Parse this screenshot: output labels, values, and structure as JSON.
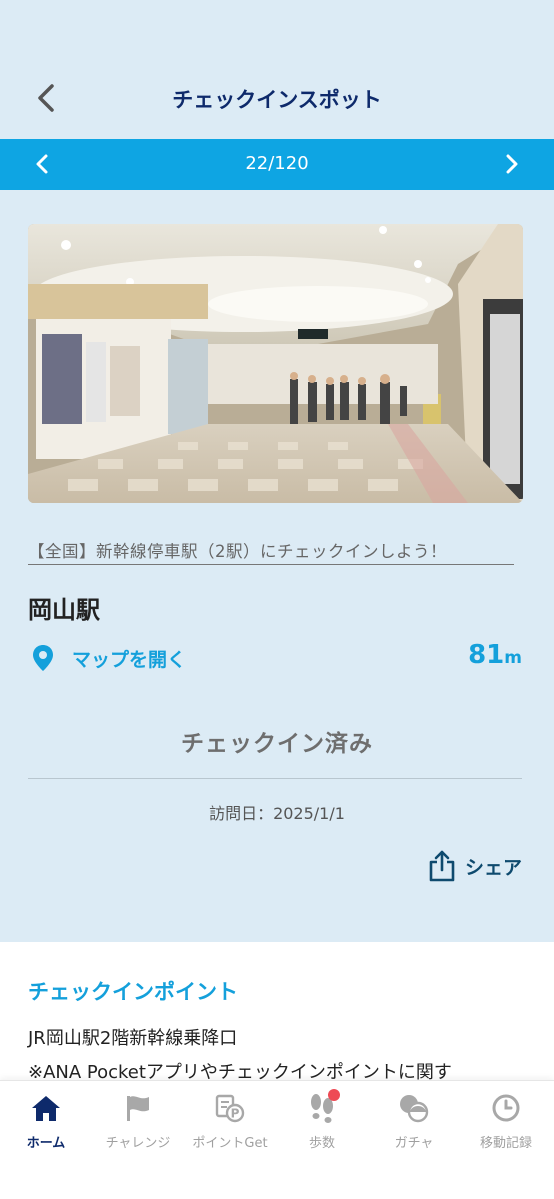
{
  "header": {
    "title": "チェックインスポット"
  },
  "pager": {
    "count": "22/120"
  },
  "spot": {
    "campaign_link": "【全国】新幹線停車駅（2駅）にチェックインしよう！",
    "name": "岡山駅",
    "map_label": "マップを開く",
    "distance_value": "81",
    "distance_unit": "m",
    "status": "チェックイン済み",
    "visit_date": "訪問日：2025/1/1",
    "share_label": "シェア"
  },
  "checkin_point": {
    "heading": "チェックインポイント",
    "line1": "JR岡山駅2階新幹線乗降口",
    "line2": "※ANA Pocketアプリやチェックインポイントに関す"
  },
  "tabs": [
    {
      "label": "ホーム",
      "icon": "home-icon"
    },
    {
      "label": "チャレンジ",
      "icon": "flag-icon"
    },
    {
      "label": "ポイントGet",
      "icon": "point-icon"
    },
    {
      "label": "歩数",
      "icon": "footsteps-icon"
    },
    {
      "label": "ガチャ",
      "icon": "gacha-icon"
    },
    {
      "label": "移動記録",
      "icon": "clock-icon"
    }
  ],
  "colors": {
    "accent": "#0ea5e3",
    "title": "#0e2a6b",
    "background": "#dcebf5",
    "badge": "#ee4a55"
  }
}
